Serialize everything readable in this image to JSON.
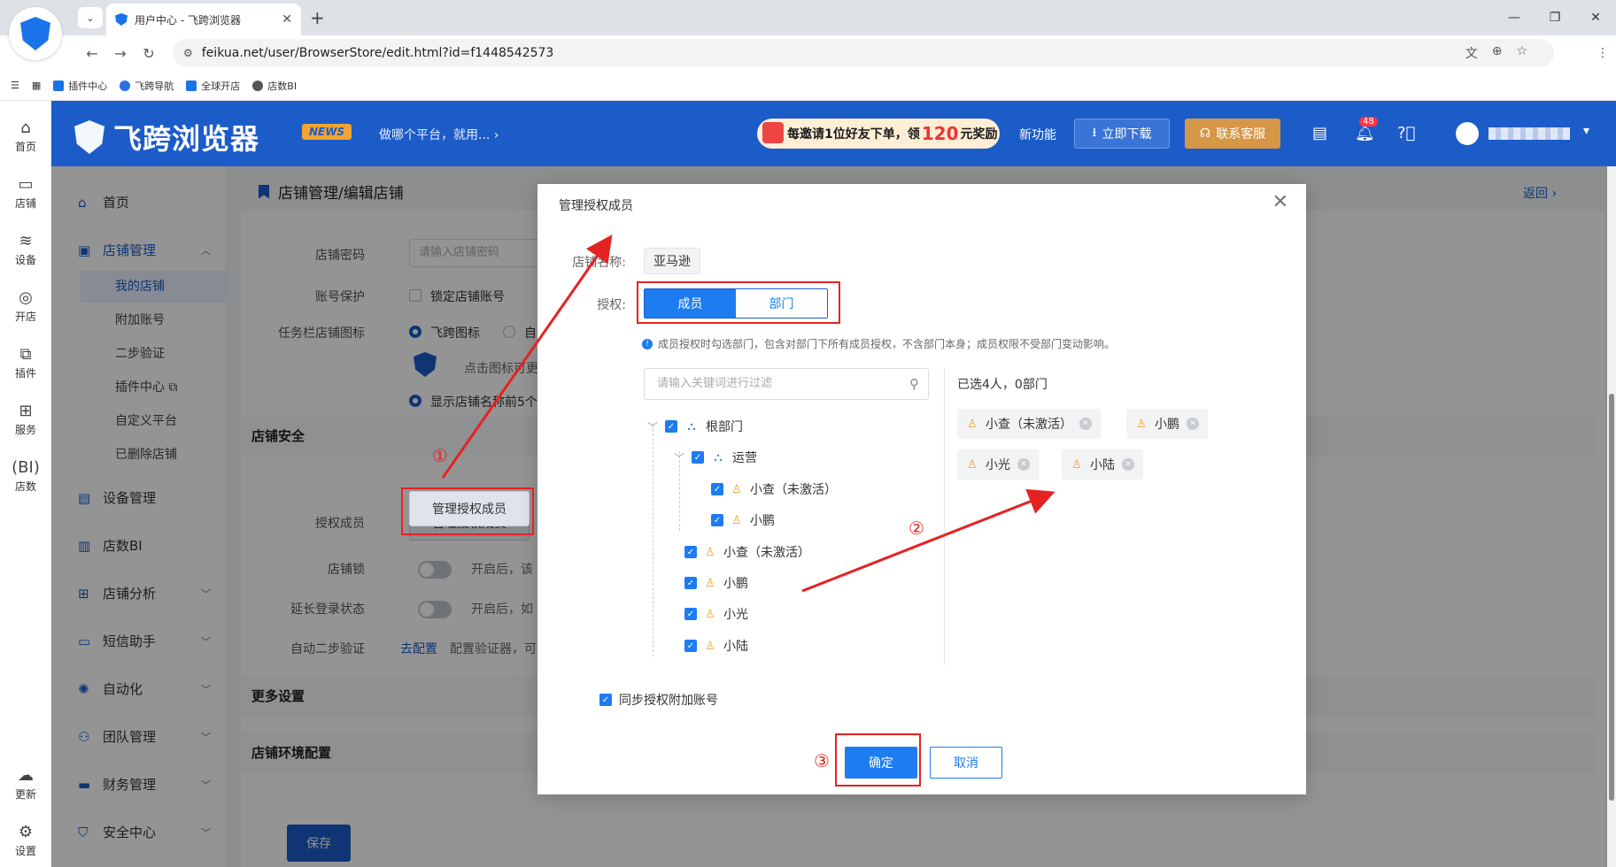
{
  "browser": {
    "tab_title": "用户中心 - 飞跨浏览器",
    "url": "feikua.net/user/BrowserStore/edit.html?id=f1448542573",
    "bookmarks": [
      "插件中心",
      "飞跨导航",
      "全球开店",
      "店数BI"
    ]
  },
  "header": {
    "logo_text": "飞跨浏览器",
    "news_badge": "NEWS",
    "news_text": "做哪个平台，就用...",
    "promo_prefix": "每邀请1位好友下单，领",
    "promo_amount": "120",
    "promo_suffix": "元奖励",
    "new_features": "新功能",
    "download_label": "立即下载",
    "service_label": "联系客服",
    "notification_count": "48"
  },
  "rail": {
    "items": [
      "首页",
      "店铺",
      "设备",
      "开店",
      "插件",
      "服务",
      "店数",
      "更新",
      "设置"
    ]
  },
  "sidebar": {
    "home": "首页",
    "store_mgmt": "店铺管理",
    "subs": [
      "我的店铺",
      "附加账号",
      "二步验证",
      "插件中心",
      "自定义平台",
      "已删除店铺"
    ],
    "device_mgmt": "设备管理",
    "store_bi": "店数BI",
    "store_analysis": "店铺分析",
    "sms_helper": "短信助手",
    "automation": "自动化",
    "team_mgmt": "团队管理",
    "finance_mgmt": "财务管理",
    "security_center": "安全中心"
  },
  "page": {
    "title": "店铺管理/编辑店铺",
    "back": "返回",
    "store_password_label": "店铺密码",
    "store_password_placeholder": "请输入店铺密码",
    "account_protect_label": "账号保护",
    "account_protect_text": "锁定店铺账号",
    "taskbar_icon_label": "任务栏店铺图标",
    "taskbar_icon_opt1": "飞跨图标",
    "taskbar_icon_opt2": "自",
    "icon_hint": "点击图标可更",
    "show_name_text": "显示店铺名称前5个",
    "store_security_head": "店铺安全",
    "authorized_members_label": "授权成员",
    "manage_members_button": "管理授权成员",
    "store_lock_label": "店铺锁",
    "store_lock_hint": "开启后，该",
    "extend_login_label": "延长登录状态",
    "extend_login_hint": "开启后，如",
    "auto_2fa_label": "自动二步验证",
    "auto_2fa_link": "去配置",
    "auto_2fa_hint": "配置验证器，可",
    "more_settings_head": "更多设置",
    "env_config_head": "店铺环境配置",
    "save_button": "保存"
  },
  "modal": {
    "title": "管理授权成员",
    "store_name_label": "店铺名称:",
    "store_name_value": "亚马逊",
    "auth_label": "授权:",
    "seg_member": "成员",
    "seg_dept": "部门",
    "tip": "成员授权时勾选部门，包含对部门下所有成员授权，不含部门本身；成员权限不受部门变动影响。",
    "search_placeholder": "请输入关键词进行过滤",
    "tree": {
      "root": "根部门",
      "ops": "运营",
      "ops_members": [
        "小查（未激活）",
        "小鹏"
      ],
      "root_members": [
        "小查（未激活）",
        "小鹏",
        "小光",
        "小陆"
      ]
    },
    "selected_summary": "已选4人，0部门",
    "selected_chips": [
      "小查（未激活）",
      "小鹏",
      "小光",
      "小陆"
    ],
    "sync_label": "同步授权附加账号",
    "ok_button": "确定",
    "cancel_button": "取消"
  },
  "annotations": {
    "step1": "①",
    "step2": "②",
    "step3": "③",
    "color": "#e52222"
  }
}
